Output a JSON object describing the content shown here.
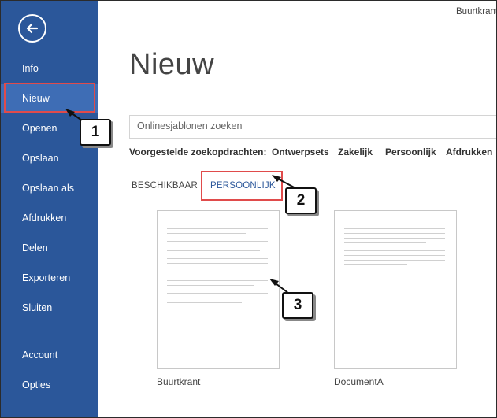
{
  "window": {
    "document_title": "Buurtkrant"
  },
  "sidebar": {
    "back_icon": "back-arrow-icon",
    "items": [
      {
        "label": "Info"
      },
      {
        "label": "Nieuw",
        "selected": true
      },
      {
        "label": "Openen"
      },
      {
        "label": "Opslaan"
      },
      {
        "label": "Opslaan als"
      },
      {
        "label": "Afdrukken"
      },
      {
        "label": "Delen"
      },
      {
        "label": "Exporteren"
      },
      {
        "label": "Sluiten"
      },
      {
        "label": "Account"
      },
      {
        "label": "Opties"
      }
    ]
  },
  "main": {
    "title": "Nieuw",
    "search": {
      "placeholder": "Onlinesjablonen zoeken"
    },
    "suggested": {
      "label": "Voorgestelde zoekopdrachten:",
      "links": [
        "Ontwerpsets",
        "Zakelijk",
        "Persoonlijk",
        "Afdrukken"
      ]
    },
    "tabs": [
      {
        "label": "BESCHIKBAAR"
      },
      {
        "label": "PERSOONLIJK",
        "active": true
      }
    ],
    "templates": [
      {
        "name": "Buurtkrant"
      },
      {
        "name": "DocumentA"
      }
    ]
  },
  "callouts": [
    "1",
    "2",
    "3"
  ],
  "colors": {
    "sidebar": "#2b579a",
    "sidebar_selected": "#3e6db5",
    "highlight": "#e04b4b",
    "accent_text": "#2b579a"
  }
}
